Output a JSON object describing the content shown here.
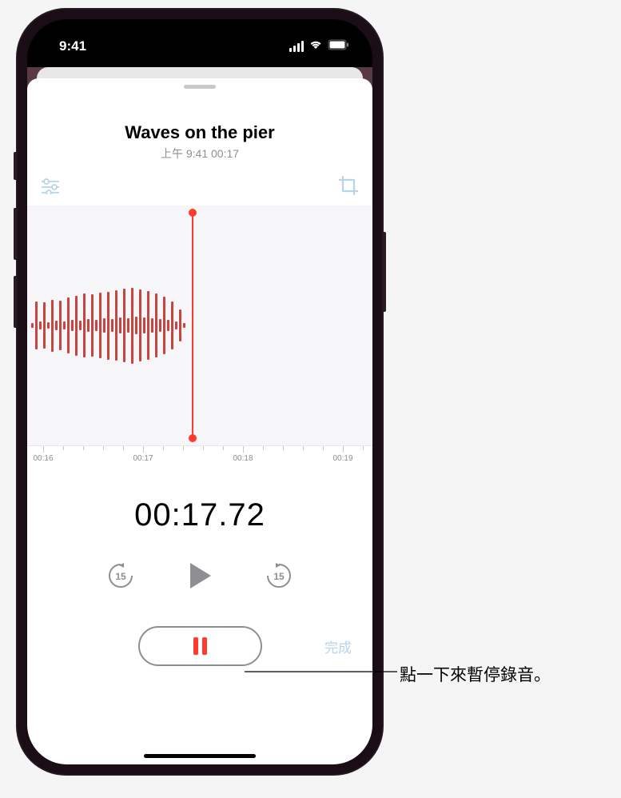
{
  "status": {
    "time": "9:41"
  },
  "recording": {
    "title": "Waves on the pier",
    "subtitle": "上午 9:41  00:17"
  },
  "ruler": {
    "t0": "00:16",
    "t1": "00:17",
    "t2": "00:18",
    "t3": "00:19"
  },
  "timer": {
    "display": "00:17.72"
  },
  "skip": {
    "amount": "15"
  },
  "buttons": {
    "done": "完成"
  },
  "callout": {
    "pause": "點一下來暫停錄音。"
  }
}
